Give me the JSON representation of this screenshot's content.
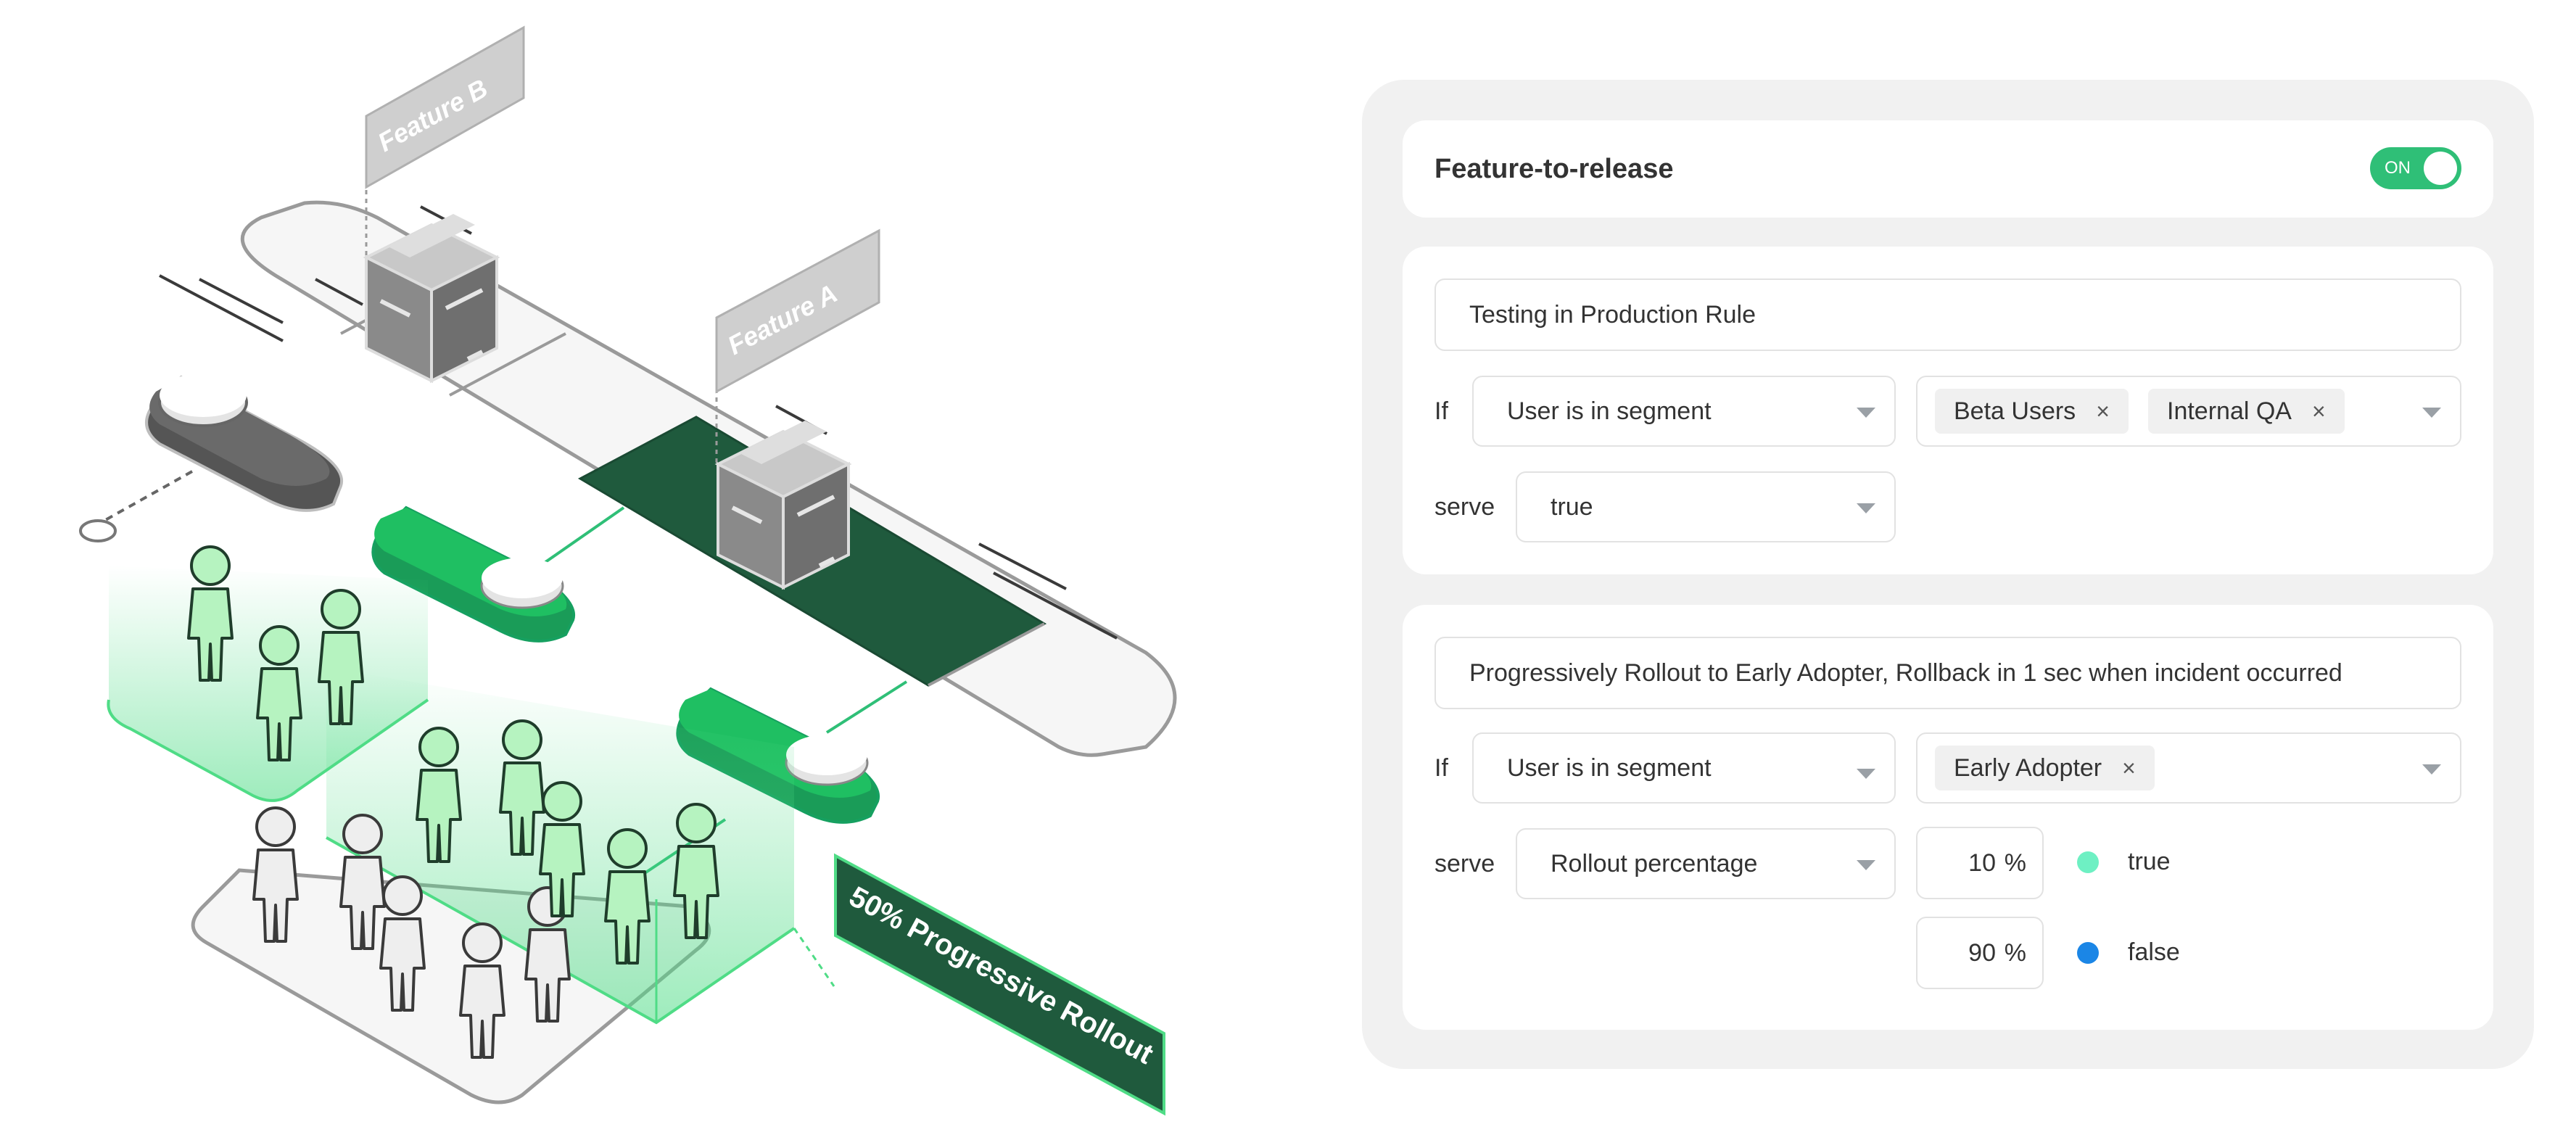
{
  "illustration": {
    "flag_b": "Feature  B",
    "flag_a": "Feature  A",
    "banner": "50% Progressive Rollout"
  },
  "colors": {
    "accent_green": "#2fbf77",
    "rollout_green": "#1a6b45",
    "person_green": "#b6f3c0",
    "true_dot": "#6ef0c3",
    "false_dot": "#1b86e6",
    "panel_bg": "#f1f1f1"
  },
  "header": {
    "title": "Feature-to-release",
    "toggle_label": "ON"
  },
  "rule1": {
    "name": "Testing in Production Rule",
    "if_label": "If",
    "condition": "User is in segment",
    "segments": [
      {
        "label": "Beta Users",
        "remove": "×"
      },
      {
        "label": "Internal QA",
        "remove": "×"
      }
    ],
    "serve_label": "serve",
    "serve_value": "true"
  },
  "rule2": {
    "name": "Progressively Rollout to Early Adopter, Rollback in 1 sec when incident occurred",
    "if_label": "If",
    "condition": "User is in segment",
    "segments": [
      {
        "label": "Early Adopter",
        "remove": "×"
      }
    ],
    "serve_label": "serve",
    "serve_value": "Rollout percentage",
    "percent_symbol": "%",
    "variations": [
      {
        "percent": "10",
        "label": "true",
        "color": "#6ef0c3"
      },
      {
        "percent": "90",
        "label": "false",
        "color": "#1b86e6"
      }
    ]
  }
}
